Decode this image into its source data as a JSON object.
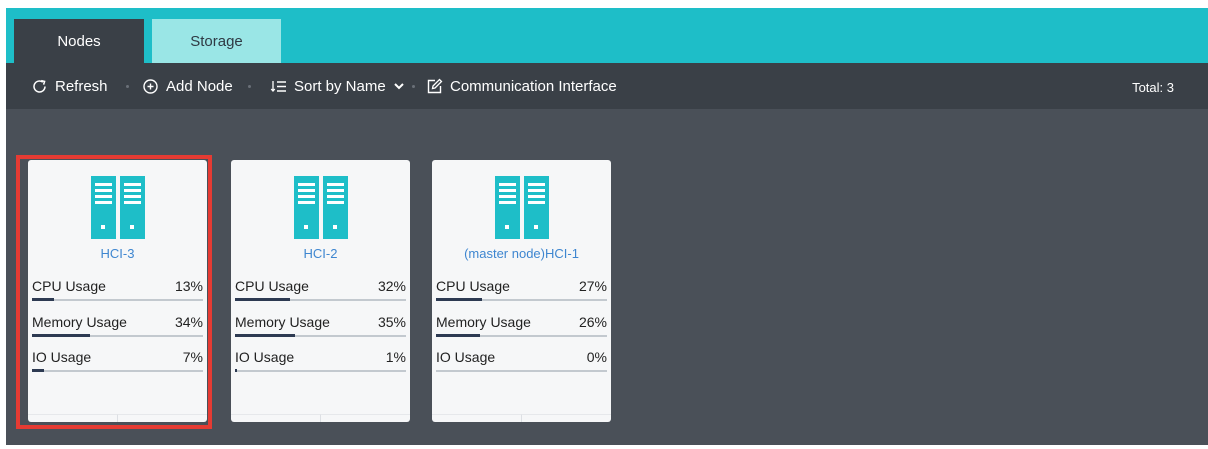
{
  "tabs": [
    {
      "label": "Nodes",
      "active": true
    },
    {
      "label": "Storage",
      "active": false
    }
  ],
  "toolbar": {
    "refresh": "Refresh",
    "add_node": "Add Node",
    "sort": "Sort by Name",
    "communication": "Communication Interface",
    "total": "Total: 3"
  },
  "nodes": [
    {
      "name": "HCI-3",
      "highlighted": true,
      "metrics": [
        {
          "label": "CPU Usage",
          "value": "13%",
          "fraction": 0.13
        },
        {
          "label": "Memory Usage",
          "value": "34%",
          "fraction": 0.34
        },
        {
          "label": "IO Usage",
          "value": "7%",
          "fraction": 0.07
        }
      ]
    },
    {
      "name": "HCI-2",
      "highlighted": false,
      "metrics": [
        {
          "label": "CPU Usage",
          "value": "32%",
          "fraction": 0.32
        },
        {
          "label": "Memory Usage",
          "value": "35%",
          "fraction": 0.35
        },
        {
          "label": "IO Usage",
          "value": "1%",
          "fraction": 0.01
        }
      ]
    },
    {
      "name": "(master node)HCI-1",
      "highlighted": false,
      "metrics": [
        {
          "label": "CPU Usage",
          "value": "27%",
          "fraction": 0.27
        },
        {
          "label": "Memory Usage",
          "value": "26%",
          "fraction": 0.26
        },
        {
          "label": "IO Usage",
          "value": "0%",
          "fraction": 0.0
        }
      ]
    }
  ],
  "colors": {
    "accent": "#1ebec8",
    "dark_toolbar": "#3a4047",
    "content_bg": "#4a5058",
    "node_name": "#3e86d0",
    "progress_fill": "#2d3a52",
    "highlight": "#e53b33"
  },
  "icons": [
    "refresh-icon",
    "add-circle-icon",
    "sort-icon",
    "chevron-down-icon",
    "edit-icon",
    "server-icon"
  ]
}
